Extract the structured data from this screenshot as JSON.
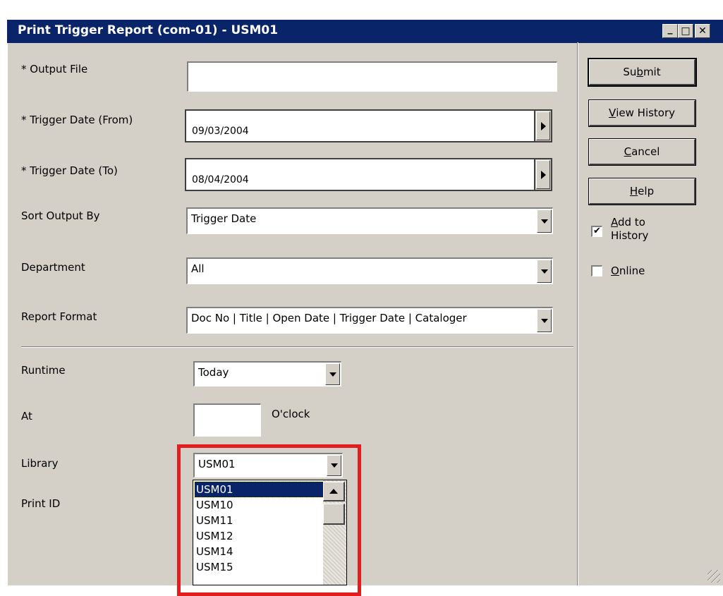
{
  "window": {
    "title": "Print Trigger Report (com-01) - USM01",
    "minimize_glyph": "_",
    "maximize_glyph": "□",
    "close_glyph": "✕"
  },
  "form": {
    "output_file": {
      "label": "* Output File",
      "value": ""
    },
    "trigger_from": {
      "label": "* Trigger Date (From)",
      "value": "09/03/2004"
    },
    "trigger_to": {
      "label": "* Trigger Date (To)",
      "value": "08/04/2004"
    },
    "sort_by": {
      "label": "Sort Output By",
      "value": "Trigger Date"
    },
    "department": {
      "label": "Department",
      "value": "All"
    },
    "report_format": {
      "label": "Report Format",
      "value": "Doc No | Title | Open Date | Trigger Date | Cataloger"
    },
    "runtime": {
      "label": "Runtime",
      "value": "Today"
    },
    "at": {
      "label": "At",
      "value": "",
      "suffix": "O'clock"
    },
    "library": {
      "label": "Library",
      "value": "USM01"
    },
    "print_id": {
      "label": "Print ID"
    }
  },
  "library_dropdown": {
    "options": [
      "USM01",
      "USM10",
      "USM11",
      "USM12",
      "USM14",
      "USM15"
    ],
    "selected": "USM01"
  },
  "side": {
    "submit": {
      "pre": "Su",
      "ul": "b",
      "post": "mit"
    },
    "view_history": {
      "pre": "",
      "ul": "V",
      "post": "iew History"
    },
    "cancel": {
      "pre": "",
      "ul": "C",
      "post": "ancel"
    },
    "help": {
      "pre": "",
      "ul": "H",
      "post": "elp"
    },
    "add_to_history": {
      "ul": "A",
      "post": "dd to",
      "line2": "History",
      "checked": true
    },
    "online": {
      "ul": "O",
      "post": "nline",
      "checked": false
    }
  },
  "colors": {
    "titlebar": "#0a246a",
    "face": "#d4d0c8",
    "highlight_box": "#e31c1c"
  },
  "icons": {
    "check": "✔"
  }
}
